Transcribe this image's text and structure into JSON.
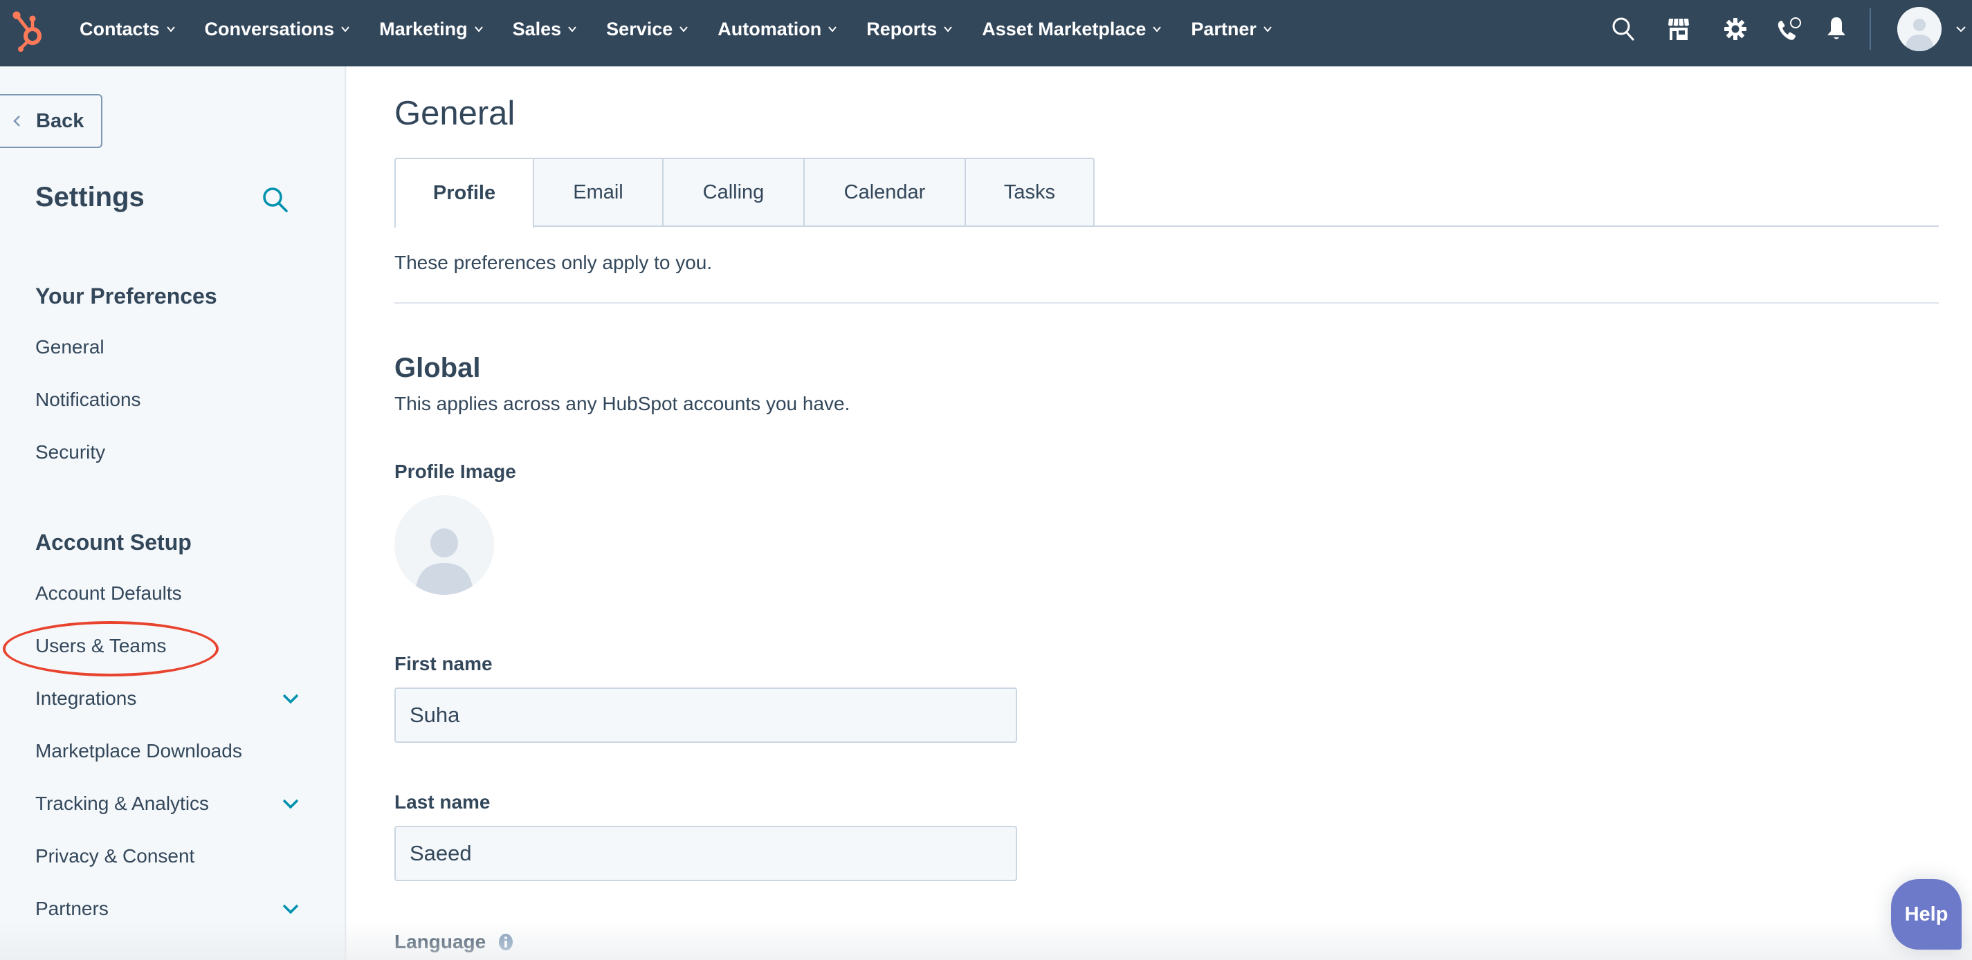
{
  "colors": {
    "nav_bg": "#33475b",
    "sidebar_bg": "#f5f8fa",
    "brand_orange": "#ff7a59",
    "link_teal": "#0091ae",
    "help_button": "#6d79c9",
    "annotation_red": "#e8432e"
  },
  "topnav": {
    "logo": "hubspot-sprocket-logo",
    "menu": [
      {
        "label": "Contacts"
      },
      {
        "label": "Conversations"
      },
      {
        "label": "Marketing"
      },
      {
        "label": "Sales"
      },
      {
        "label": "Service"
      },
      {
        "label": "Automation"
      },
      {
        "label": "Reports"
      },
      {
        "label": "Asset Marketplace"
      },
      {
        "label": "Partner"
      }
    ],
    "icons": [
      "search-icon",
      "marketplace-icon",
      "settings-gear-icon",
      "calling-icon",
      "notifications-bell-icon"
    ],
    "account_avatar": "default-user-avatar"
  },
  "sidebar": {
    "back_label": "Back",
    "title": "Settings",
    "sections": [
      {
        "title": "Your Preferences",
        "items": [
          {
            "label": "General",
            "expandable": false
          },
          {
            "label": "Notifications",
            "expandable": false
          },
          {
            "label": "Security",
            "expandable": false
          }
        ]
      },
      {
        "title": "Account Setup",
        "items": [
          {
            "label": "Account Defaults",
            "expandable": false
          },
          {
            "label": "Users & Teams",
            "expandable": false,
            "annotated": true
          },
          {
            "label": "Integrations",
            "expandable": true
          },
          {
            "label": "Marketplace Downloads",
            "expandable": false
          },
          {
            "label": "Tracking & Analytics",
            "expandable": true
          },
          {
            "label": "Privacy & Consent",
            "expandable": false
          },
          {
            "label": "Partners",
            "expandable": true
          }
        ]
      }
    ]
  },
  "main": {
    "title": "General",
    "tabs": [
      {
        "label": "Profile",
        "active": true
      },
      {
        "label": "Email",
        "active": false
      },
      {
        "label": "Calling",
        "active": false
      },
      {
        "label": "Calendar",
        "active": false
      },
      {
        "label": "Tasks",
        "active": false
      }
    ],
    "intro": "These preferences only apply to you.",
    "global": {
      "title": "Global",
      "description": "This applies across any HubSpot accounts you have.",
      "profile_image_label": "Profile Image",
      "first_name_label": "First name",
      "first_name_value": "Suha",
      "last_name_label": "Last name",
      "last_name_value": "Saeed",
      "language_label": "Language"
    }
  },
  "help_button": {
    "label": "Help"
  }
}
